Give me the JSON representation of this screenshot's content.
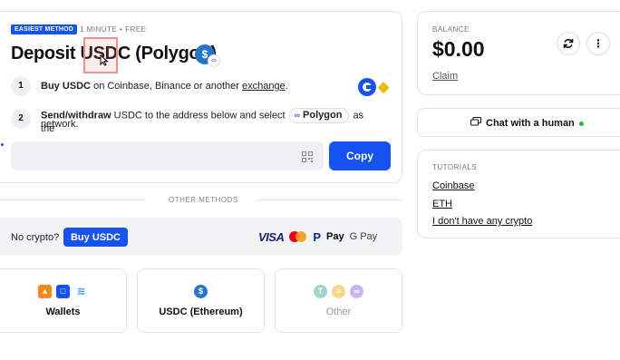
{
  "deposit": {
    "badge": "EASIEST METHOD",
    "meta": "1 MINUTE • FREE",
    "title": "Deposit USDC (Polygon)",
    "steps": [
      {
        "num": "1",
        "bold": "Buy USDC",
        "text": " on Coinbase, Binance or another ",
        "link": "exchange",
        "tail": "."
      },
      {
        "num": "2",
        "bold": "Send/withdraw",
        "text": " USDC to the address below and select",
        "pill": "Polygon",
        "tail": "as the",
        "line2": "network."
      }
    ],
    "copy_label": "Copy"
  },
  "other_methods_label": "OTHER METHODS",
  "no_crypto": {
    "label": "No crypto?",
    "button": "Buy USDC",
    "payment_logos": {
      "visa": "VISA",
      "paypal": "P",
      "applepay": "Pay",
      "gpay": "G Pay"
    }
  },
  "methods": [
    {
      "label": "Wallets"
    },
    {
      "label": "USDC (Ethereum)"
    },
    {
      "label": "Other"
    }
  ],
  "balance": {
    "label": "BALANCE",
    "value": "$0.00",
    "claim": "Claim"
  },
  "chat": {
    "label": "Chat with a human"
  },
  "tutorials": {
    "label": "TUTORIALS",
    "links": [
      "Coinbase",
      "ETH",
      "I don't have any crypto"
    ]
  },
  "colors": {
    "accent": "#1652f0",
    "online": "#2bb24c",
    "polygon": "#8247e5",
    "usdc": "#2775ca"
  }
}
